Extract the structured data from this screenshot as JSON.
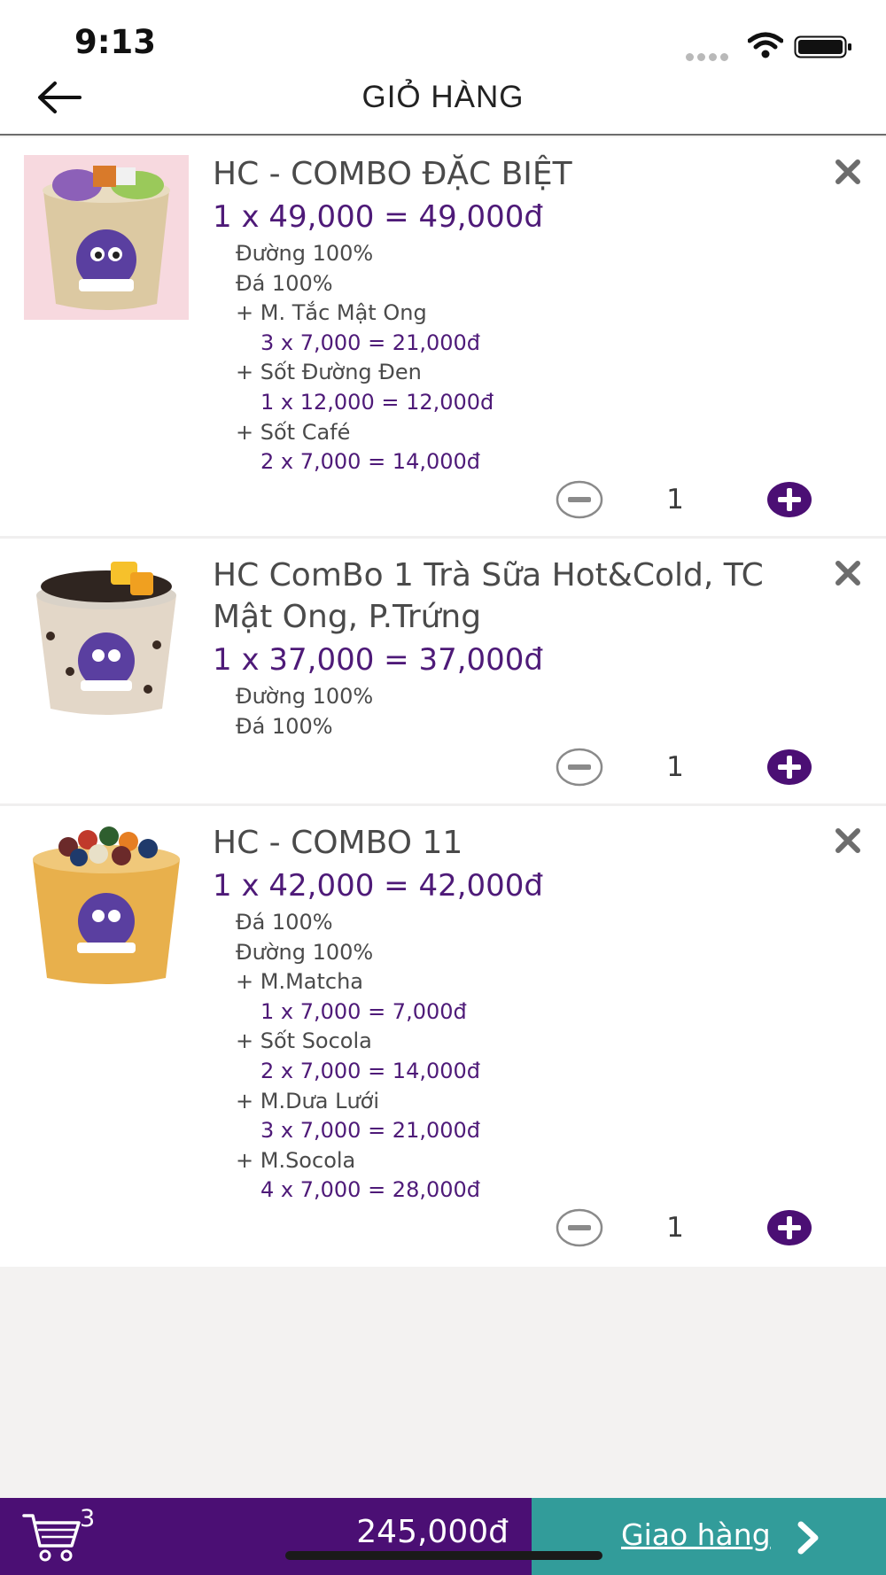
{
  "status_bar": {
    "time": "9:13"
  },
  "header": {
    "title": "GIỎ HÀNG"
  },
  "cart_items": [
    {
      "name": "HC - COMBO ĐẶC BIỆT",
      "price": "1 x 49,000 = 49,000đ",
      "options": [
        "Đường 100%",
        "Đá 100%"
      ],
      "toppings": [
        {
          "name": "+ M. Tắc Mật Ong",
          "price": "3 x 7,000 = 21,000đ"
        },
        {
          "name": "+ Sốt Đường Đen",
          "price": "1 x 12,000 = 12,000đ"
        },
        {
          "name": "+ Sốt Café",
          "price": "2 x 7,000 = 14,000đ"
        }
      ],
      "quantity": "1",
      "image_colors": {
        "bg": "#f7d9df",
        "cup": "#dcc9a2",
        "top": "#8c60b8"
      }
    },
    {
      "name": "HC ComBo 1 Trà Sữa Hot&Cold, TC Mật Ong, P.Trứng",
      "price": "1 x 37,000 = 37,000đ",
      "options": [
        "Đường 100%",
        "Đá 100%"
      ],
      "toppings": [],
      "quantity": "1",
      "image_colors": {
        "bg": "#ffffff",
        "cup": "#e3d7c8",
        "top": "#2f2520"
      }
    },
    {
      "name": "HC - COMBO 11",
      "price": "1 x 42,000 = 42,000đ",
      "options": [
        "Đá 100%",
        "Đường 100%"
      ],
      "toppings": [
        {
          "name": "+ M.Matcha",
          "price": "1 x 7,000 = 7,000đ"
        },
        {
          "name": "+ Sốt Socola",
          "price": "2 x 7,000 = 14,000đ"
        },
        {
          "name": "+ M.Dưa Lưới",
          "price": "3 x 7,000 = 21,000đ"
        },
        {
          "name": "+ M.Socola",
          "price": "4 x 7,000 = 28,000đ"
        }
      ],
      "quantity": "1",
      "image_colors": {
        "bg": "#ffffff",
        "cup": "#e8b04c",
        "top": "#6b2a2a"
      }
    }
  ],
  "footer": {
    "cart_count": "3",
    "total": "245,000đ",
    "checkout_label": "Giao hàng"
  },
  "colors": {
    "accent": "#4b0f74",
    "checkout": "#329c9a",
    "price": "#4e1a78"
  },
  "icons": [
    "back-arrow-icon",
    "wifi-icon",
    "battery-icon",
    "close-icon",
    "minus-circle-icon",
    "plus-circle-icon",
    "cart-icon",
    "chevron-right-icon"
  ]
}
